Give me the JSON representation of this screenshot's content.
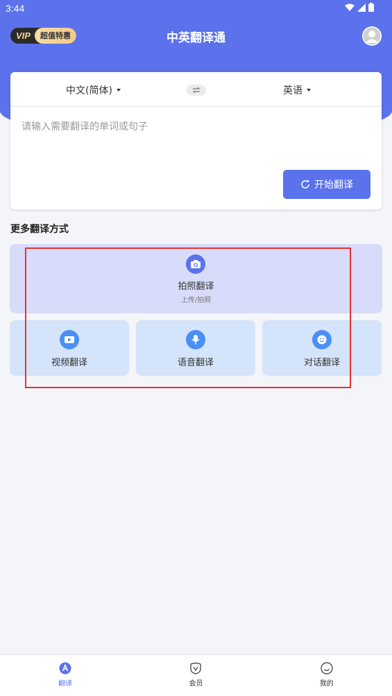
{
  "status": {
    "time": "3:44"
  },
  "header": {
    "vip_label": "VIP",
    "vip_promo": "超值特惠",
    "title": "中英翻译通"
  },
  "translator": {
    "source_lang": "中文(简体)",
    "target_lang": "英语",
    "input_placeholder": "请输入需要翻译的单词或句子",
    "translate_button": "开始翻译"
  },
  "more": {
    "title": "更多翻译方式",
    "photo": {
      "label": "拍照翻译",
      "sub": "上传/拍照",
      "icon": "camera-icon"
    },
    "video": {
      "label": "视频翻译",
      "icon": "video-icon"
    },
    "voice": {
      "label": "语音翻译",
      "icon": "microphone-icon"
    },
    "dialog": {
      "label": "对话翻译",
      "icon": "smile-icon"
    }
  },
  "nav": {
    "items": [
      {
        "label": "翻译",
        "icon": "translate-icon",
        "active": true
      },
      {
        "label": "会员",
        "icon": "vip-shield-icon",
        "active": false
      },
      {
        "label": "我的",
        "icon": "profile-smile-icon",
        "active": false
      }
    ]
  },
  "colors": {
    "primary": "#5b72ec",
    "accent_blue": "#4a8ff5",
    "highlight": "#e8312f"
  }
}
